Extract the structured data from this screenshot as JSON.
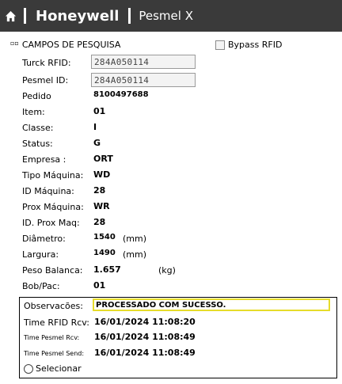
{
  "header": {
    "brand": "Honeywell",
    "app": "Pesmel X"
  },
  "section": {
    "title": "CAMPOS DE PESQUISA",
    "bypass_label": "Bypass RFID"
  },
  "fields": {
    "turck_rfid": {
      "label": "Turck RFID:",
      "value": "284A050114"
    },
    "pesmel_id": {
      "label": "Pesmel ID:",
      "value": "284A050114"
    },
    "pedido": {
      "label": "Pedido",
      "value": "8100497688"
    },
    "item": {
      "label": "Item:",
      "value": "01"
    },
    "classe": {
      "label": "Classe:",
      "value": "I"
    },
    "status": {
      "label": "Status:",
      "value": "G"
    },
    "empresa": {
      "label": "Empresa :",
      "value": "ORT"
    },
    "tipo_maquina": {
      "label": "Tipo Máquina:",
      "value": "WD"
    },
    "id_maquina": {
      "label": "ID Máquina:",
      "value": "28"
    },
    "prox_maquina": {
      "label": "Prox Máquina:",
      "value": "WR"
    },
    "id_prox_maq": {
      "label": "ID. Prox Maq:",
      "value": "28"
    },
    "diametro": {
      "label": "Diâmetro:",
      "value": "1540",
      "unit": "(mm)"
    },
    "largura": {
      "label": "Largura:",
      "value": "1490",
      "unit": "(mm)"
    },
    "peso_balanca": {
      "label": "Peso Balanca:",
      "value": "1.657",
      "unit": "(kg)"
    },
    "bob_pac": {
      "label": "Bob/Pac:",
      "value": "01"
    }
  },
  "observacoes": {
    "label": "Observacões:",
    "value": "PROCESSADO COM SUCESSO.",
    "time_rfid_rcv": {
      "label": "Time RFID Rcv:",
      "value": "16/01/2024 11:08:20"
    },
    "time_pesmel_rcv": {
      "label": "Time Pesmel Rcv:",
      "value": "16/01/2024 11:08:49"
    },
    "time_pesmel_send": {
      "label": "Time Pesmel Send:",
      "value": "16/01/2024 11:08:49"
    },
    "select_label": "Selecionar"
  },
  "icons": {
    "home": "home-icon"
  },
  "colors": {
    "header_bg": "#3a3a3a",
    "obs_highlight": "#e6dc2a"
  }
}
